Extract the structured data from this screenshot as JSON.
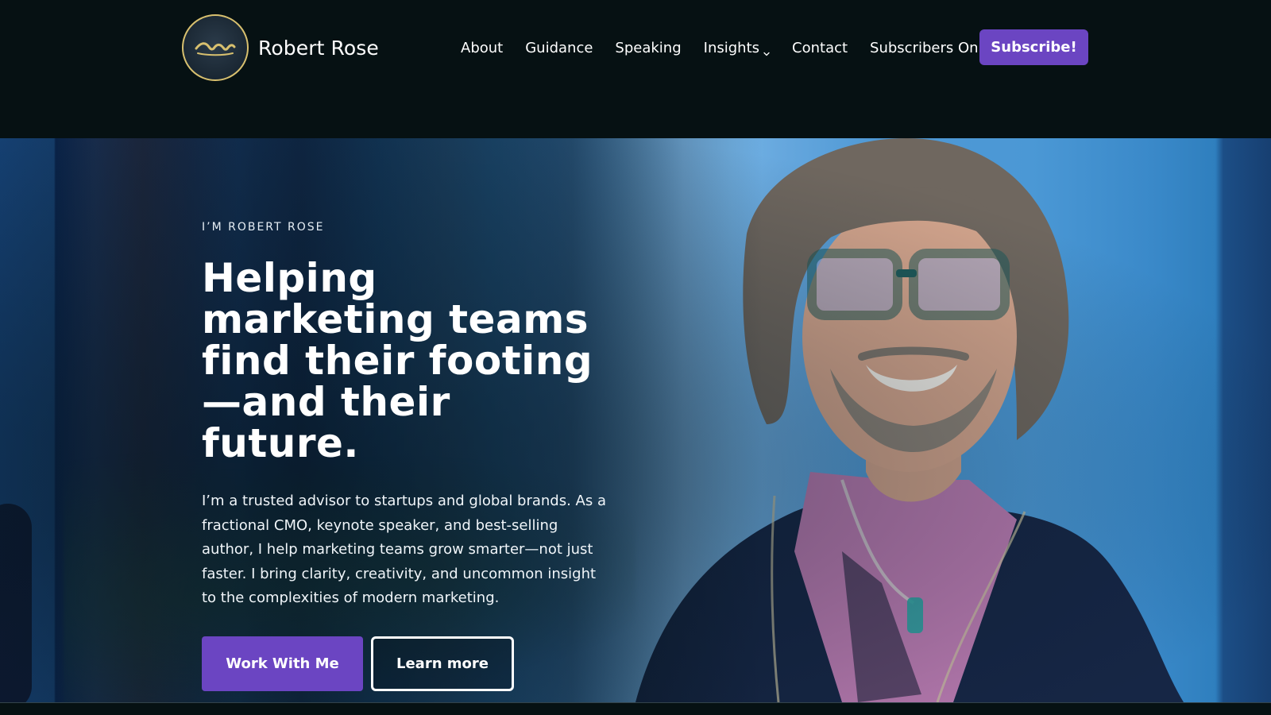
{
  "header": {
    "brand_name": "Robert Rose",
    "logo_icon": "wave-monogram-icon",
    "nav": [
      {
        "label": "About"
      },
      {
        "label": "Guidance"
      },
      {
        "label": "Speaking"
      },
      {
        "label": "Insights",
        "has_dropdown": true
      },
      {
        "label": "Contact"
      },
      {
        "label": "Subscribers Only"
      }
    ],
    "subscribe_label": "Subscribe!"
  },
  "hero": {
    "eyebrow": "I’M ROBERT ROSE",
    "headline": "Helping marketing teams find their footing—and their future.",
    "lede": "I’m a trusted advisor to startups and global brands. As a fractional CMO, keynote speaker, and best-selling author, I help marketing teams grow smarter—not just faster. I bring clarity, creativity, and uncommon insight to the complexities of modern marketing.",
    "primary_cta": "Work With Me",
    "secondary_cta": "Learn more"
  },
  "colors": {
    "background": "#061113",
    "accent_purple": "#6b45c2",
    "logo_gold": "#d8c06f",
    "text_white": "#ffffff"
  }
}
